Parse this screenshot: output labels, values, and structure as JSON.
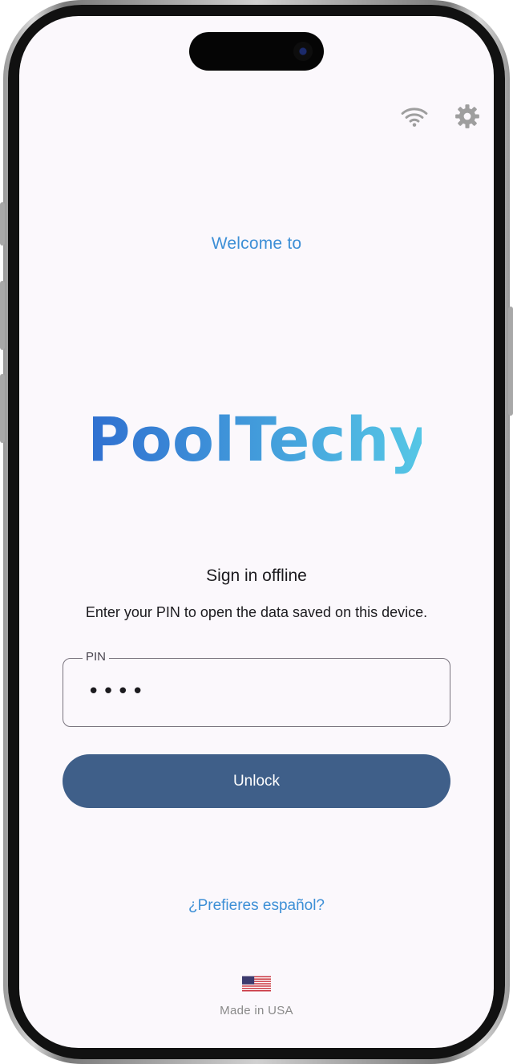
{
  "welcome_text": "Welcome to",
  "brand": {
    "name": "PoolTechy",
    "gradient_start": "#2f6fd0",
    "gradient_end": "#56c8e6"
  },
  "top_bar": {
    "icons": [
      "wifi-icon",
      "gear-icon"
    ]
  },
  "signin": {
    "title": "Sign in offline",
    "subtitle": "Enter your PIN to open the data saved on this device.",
    "pin_label": "PIN",
    "pin_value": "••••",
    "unlock_label": "Unlock"
  },
  "language_link": "¿Prefieres español?",
  "footer": {
    "flag_icon": "us-flag-icon",
    "made_in": "Made in USA"
  },
  "colors": {
    "accent_link": "#3d8fd6",
    "button": "#3f5f89",
    "background": "#fbf8fc",
    "icon_gray": "#9e9e9e"
  }
}
